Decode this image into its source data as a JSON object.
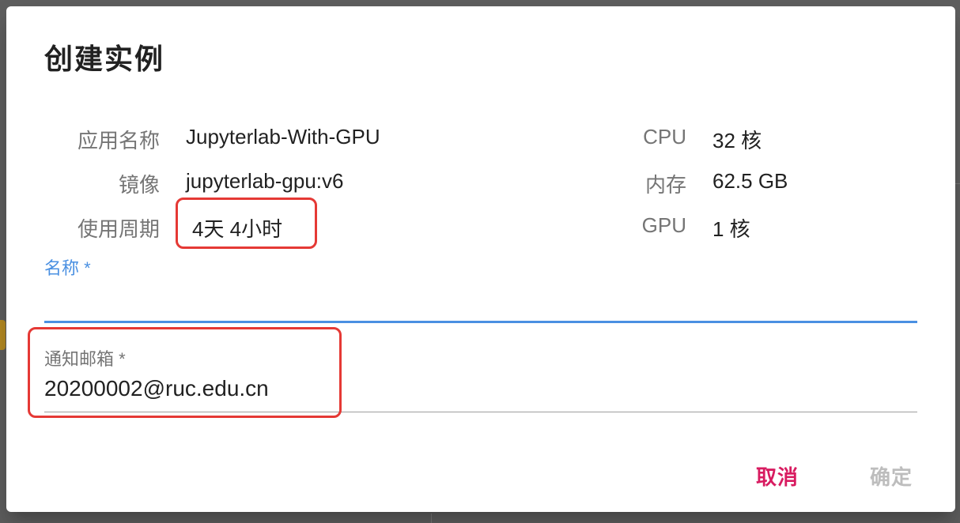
{
  "dialog": {
    "title": "创建实例",
    "info_left": [
      {
        "label": "应用名称",
        "value": "Jupyterlab-With-GPU"
      },
      {
        "label": "镜像",
        "value": "jupyterlab-gpu:v6"
      },
      {
        "label": "使用周期",
        "value": "4天 4小时"
      }
    ],
    "info_right": [
      {
        "label": "CPU",
        "value": "32 核"
      },
      {
        "label": "内存",
        "value": "62.5 GB"
      },
      {
        "label": "GPU",
        "value": "1 核"
      }
    ],
    "name_field": {
      "label": "名称 *",
      "value": ""
    },
    "email_field": {
      "label": "通知邮箱 *",
      "value": "20200002@ruc.edu.cn"
    },
    "actions": {
      "cancel_label": "取消",
      "confirm_label": "确定"
    }
  },
  "colors": {
    "primary_blue": "#4a90e2",
    "cancel_red": "#d81b60",
    "disabled_text": "#bdbdbd",
    "highlight_red": "#e53935"
  }
}
